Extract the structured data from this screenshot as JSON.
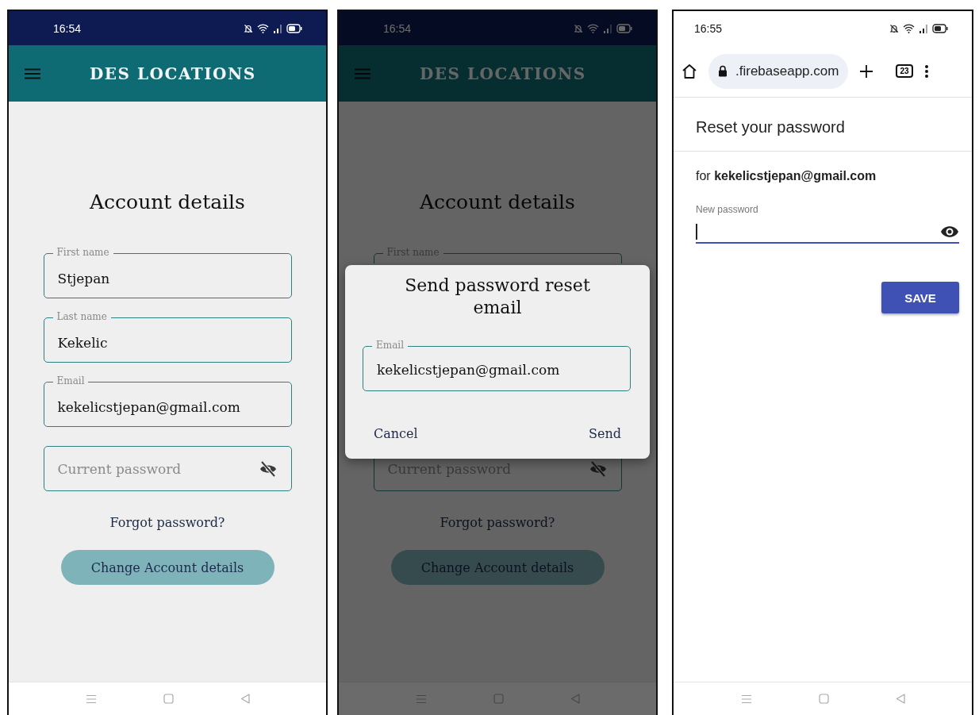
{
  "screens": [
    {
      "kind": "app",
      "dimmed": false,
      "status_bar": {
        "time": "16:54"
      },
      "app_bar": {
        "title": "DES LOCATIONS"
      },
      "page": {
        "title": "Account details",
        "fields": [
          {
            "kind": "text",
            "label": "First name",
            "value": "Stjepan"
          },
          {
            "kind": "text",
            "label": "Last name",
            "value": "Kekelic"
          },
          {
            "kind": "text",
            "label": "Email",
            "value": "kekelicstjepan@gmail.com"
          },
          {
            "kind": "password",
            "placeholder": "Current password",
            "masked": true
          }
        ],
        "link": "Forgot password?",
        "button": "Change Account details"
      }
    },
    {
      "kind": "app",
      "dimmed": true,
      "status_bar": {
        "time": "16:54"
      },
      "app_bar": {
        "title": "DES LOCATIONS"
      },
      "page": {
        "title": "Account details",
        "fields": [
          {
            "kind": "text",
            "label": "First name"
          },
          {
            "kind": "password",
            "placeholder": "Current password",
            "masked": true
          }
        ],
        "link": "Forgot password?",
        "button": "Change Account details"
      },
      "dialog": {
        "title": "Send password reset email",
        "field": {
          "label": "Email",
          "value": "kekelicstjepan@gmail.com"
        },
        "actions": [
          "Cancel",
          "Send"
        ]
      }
    },
    {
      "kind": "browser",
      "status_bar": {
        "time": "16:55"
      },
      "toolbar": {
        "url": ".firebaseapp.com",
        "tab_count": "23"
      },
      "page": {
        "title": "Reset your password",
        "subtitle": "for **kekelicstjepan@gmail.com**",
        "field": {
          "label": "New password",
          "masked": false
        },
        "button": "SAVE"
      }
    }
  ]
}
